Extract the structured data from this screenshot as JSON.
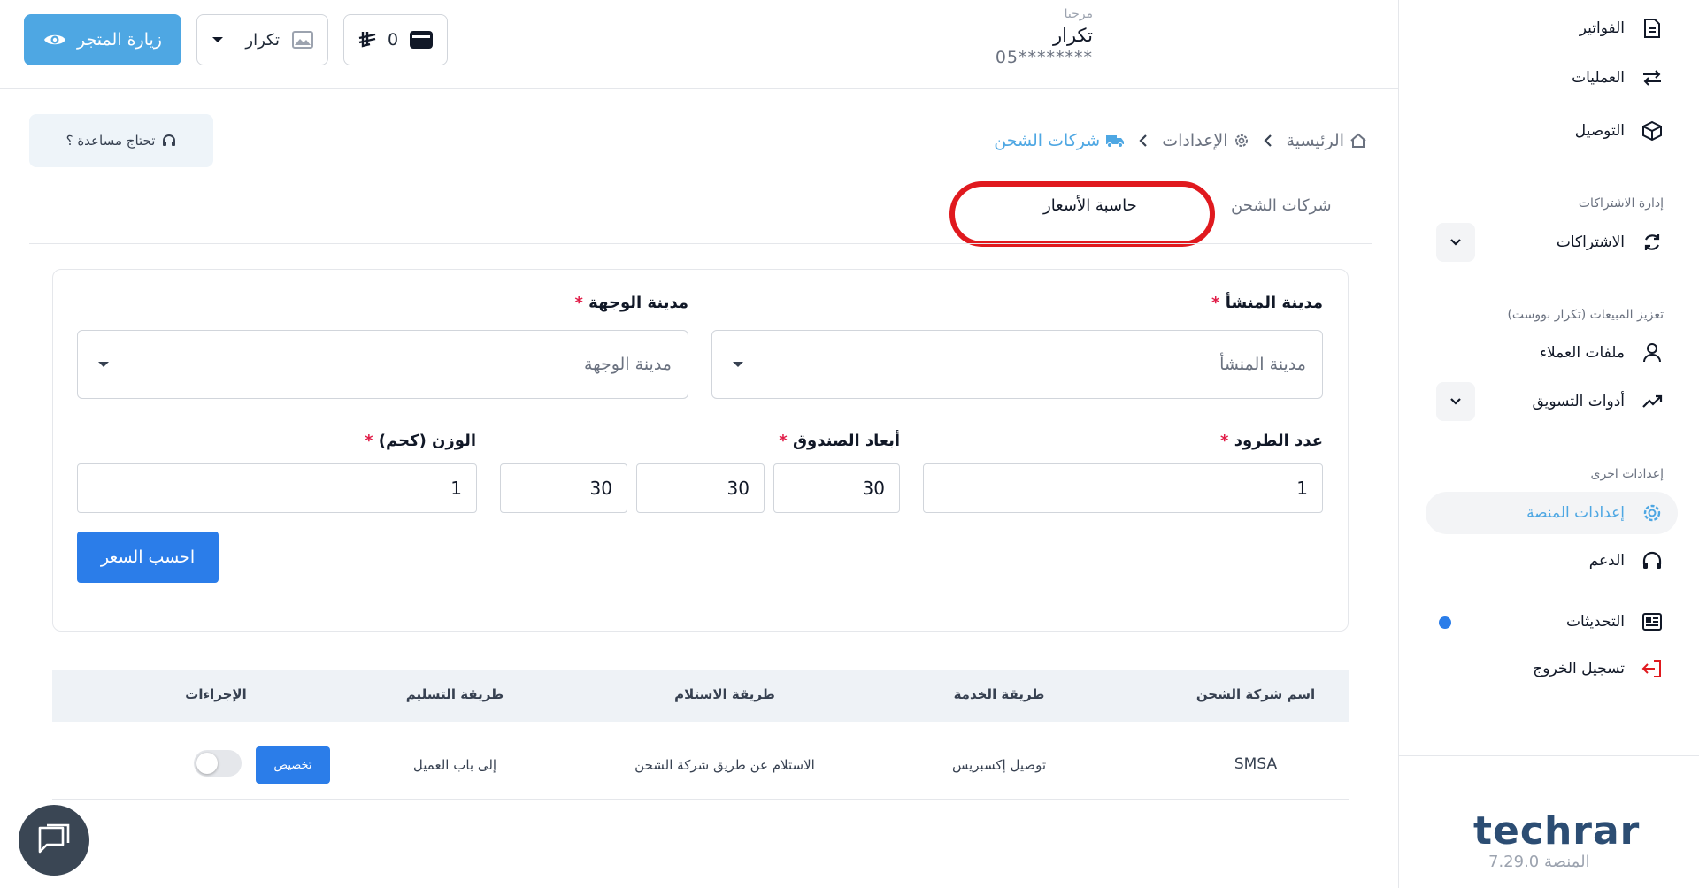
{
  "header": {
    "greeting": "مرحبا",
    "store_name": "تكرار",
    "phone": "05********",
    "wallet_balance": "0",
    "store_select_label": "تكرار",
    "visit_store_label": "زيارة المتجر"
  },
  "breadcrumb": {
    "home": "الرئيسية",
    "settings": "الإعدادات",
    "current": "شركات الشحن"
  },
  "help_label": "تحتاج مساعدة ؟",
  "tabs": {
    "shipping_companies": "شركات الشحن",
    "price_calculator": "حاسبة الأسعار"
  },
  "form": {
    "origin_label": "مدينة المنشأ",
    "origin_placeholder": "مدينة المنشأ",
    "destination_label": "مدينة الوجهة",
    "destination_placeholder": "مدينة الوجهة",
    "required_mark": "*",
    "parcels_label": "عدد الطرود",
    "parcels_value": "1",
    "box_dims_label": "أبعاد الصندوق",
    "box_length": "30",
    "box_width": "30",
    "box_height": "30",
    "weight_label": "الوزن (كجم)",
    "weight_value": "1",
    "calculate_label": "احسب السعر"
  },
  "table": {
    "headers": [
      "اسم شركة الشحن",
      "طريقة الخدمة",
      "طريقة الاستلام",
      "طريقة التسليم",
      "الإجراءات"
    ],
    "rows": [
      {
        "company": "SMSA",
        "service": "توصيل إكسبريس",
        "pickup": "الاستلام عن طريق شركة الشحن",
        "delivery": "إلى باب العميل",
        "customize_label": "تخصيص"
      }
    ]
  },
  "sidebar": {
    "items": {
      "invoices": "الفواتير",
      "operations": "العمليات",
      "delivery": "التوصيل",
      "subscriptions": "الاشتراكات",
      "customer_files": "ملفات العملاء",
      "marketing_tools": "أدوات التسويق",
      "platform_settings": "إعدادات المنصة",
      "support": "الدعم",
      "updates": "التحديثات",
      "logout": "تسجيل الخروج"
    },
    "sections": {
      "subscription_mgmt": "إدارة الاشتراكات",
      "sales_boost": "تعزيز المبيعات (تكرار بووست)",
      "other_settings": "إعدادات اخرى"
    }
  },
  "brand": {
    "logo": "techrar",
    "version": "المنصة 7.29.0"
  },
  "colors": {
    "primary": "#2b7de9",
    "visit_button": "#4ea7e3",
    "active_text": "#4ea7e3",
    "highlight_ring": "#e0191e",
    "brand": "#2c4d73"
  }
}
